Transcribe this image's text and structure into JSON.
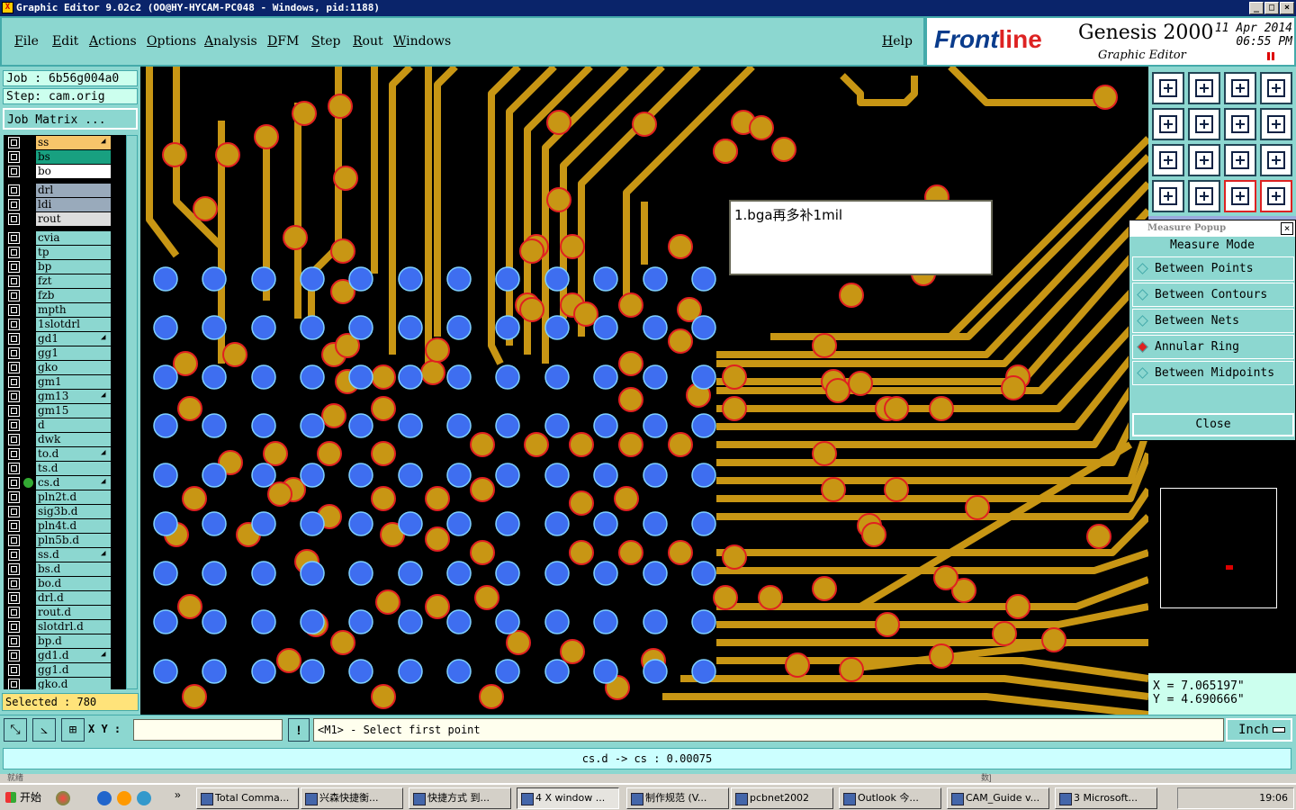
{
  "title": "Graphic Editor 9.02c2  (OO@HY-HYCAM-PC048 - Windows, pid:1188)",
  "menu": [
    "File",
    "Edit",
    "Actions",
    "Options",
    "Analysis",
    "DFM",
    "Step",
    "Rout",
    "Windows"
  ],
  "help": "Help",
  "brand": {
    "logo_a": "Front",
    "logo_b": "line",
    "product": "Genesis 2000",
    "subtitle": "Graphic Editor",
    "date": "11 Apr 2014",
    "time": "06:55 PM"
  },
  "job": "Job : 6b56g004a0",
  "step": "Step: cam.orig",
  "job_matrix": "Job Matrix ...",
  "layers": [
    {
      "name": "ss",
      "color": "#f7c56a",
      "mark": "◢"
    },
    {
      "name": "bs",
      "color": "#18a080",
      "mark": ""
    },
    {
      "name": "bo",
      "color": "#ffffff",
      "mark": ""
    },
    {
      "name": "drl",
      "color": "#9ab",
      "mark": "",
      "gap": true
    },
    {
      "name": "ldi",
      "color": "#9ab",
      "mark": ""
    },
    {
      "name": "rout",
      "color": "#ddd",
      "mark": ""
    },
    {
      "name": "cvia",
      "color": "#8cd7d0",
      "mark": "",
      "gap": true
    },
    {
      "name": "tp",
      "color": "#8cd7d0",
      "mark": ""
    },
    {
      "name": "bp",
      "color": "#8cd7d0",
      "mark": ""
    },
    {
      "name": "fzt",
      "color": "#8cd7d0",
      "mark": ""
    },
    {
      "name": "fzb",
      "color": "#8cd7d0",
      "mark": ""
    },
    {
      "name": "mpth",
      "color": "#8cd7d0",
      "mark": ""
    },
    {
      "name": "1slotdrl",
      "color": "#8cd7d0",
      "mark": ""
    },
    {
      "name": "gd1",
      "color": "#8cd7d0",
      "mark": "◢"
    },
    {
      "name": "gg1",
      "color": "#8cd7d0",
      "mark": ""
    },
    {
      "name": "gko",
      "color": "#8cd7d0",
      "mark": ""
    },
    {
      "name": "gm1",
      "color": "#8cd7d0",
      "mark": ""
    },
    {
      "name": "gm13",
      "color": "#8cd7d0",
      "mark": "◢"
    },
    {
      "name": "gm15",
      "color": "#8cd7d0",
      "mark": ""
    },
    {
      "name": "d",
      "color": "#8cd7d0",
      "mark": ""
    },
    {
      "name": "dwk",
      "color": "#8cd7d0",
      "mark": ""
    },
    {
      "name": "to.d",
      "color": "#8cd7d0",
      "mark": "◢"
    },
    {
      "name": "ts.d",
      "color": "#8cd7d0",
      "mark": ""
    },
    {
      "name": "cs.d",
      "color": "#8cd7d0",
      "mark": "◢",
      "active": true
    },
    {
      "name": "pln2t.d",
      "color": "#8cd7d0",
      "mark": ""
    },
    {
      "name": "sig3b.d",
      "color": "#8cd7d0",
      "mark": ""
    },
    {
      "name": "pln4t.d",
      "color": "#8cd7d0",
      "mark": ""
    },
    {
      "name": "pln5b.d",
      "color": "#8cd7d0",
      "mark": ""
    },
    {
      "name": "ss.d",
      "color": "#8cd7d0",
      "mark": "◢"
    },
    {
      "name": "bs.d",
      "color": "#8cd7d0",
      "mark": ""
    },
    {
      "name": "bo.d",
      "color": "#8cd7d0",
      "mark": ""
    },
    {
      "name": "drl.d",
      "color": "#8cd7d0",
      "mark": ""
    },
    {
      "name": "rout.d",
      "color": "#8cd7d0",
      "mark": ""
    },
    {
      "name": "slotdrl.d",
      "color": "#8cd7d0",
      "mark": ""
    },
    {
      "name": "bp.d",
      "color": "#8cd7d0",
      "mark": ""
    },
    {
      "name": "gd1.d",
      "color": "#8cd7d0",
      "mark": "◢"
    },
    {
      "name": "gg1.d",
      "color": "#8cd7d0",
      "mark": ""
    },
    {
      "name": "gko.d",
      "color": "#8cd7d0",
      "mark": ""
    }
  ],
  "selected": "Selected : 780",
  "note": "1.bga再多补1mil",
  "measure": {
    "title": "Measure Popup",
    "mode_label": "Measure Mode",
    "options": [
      "Between Points",
      "Between Contours",
      "Between Nets",
      "Annular Ring",
      "Between Midpoints"
    ],
    "selected_option": "Annular Ring",
    "close": "Close"
  },
  "coords": {
    "x": "X = 7.065197\"",
    "y": "Y = 4.690666\""
  },
  "xy_label": "X Y :",
  "prompt": "<M1> - Select first point",
  "unit": "Inch",
  "status": "cs.d -> cs : 0.00075",
  "statusline": "就绪",
  "statusline_right": "数]",
  "colors": {
    "board": "#000000",
    "trace": "#c89614",
    "pad": "#c89614",
    "pad_ring": "#e02020",
    "bga": "#3e6ef0",
    "bga_ring": "#7fd0ff"
  },
  "taskbar": {
    "start": "开始",
    "tasks": [
      "Total Comma...",
      "兴森快捷衡...",
      "快捷方式 到...",
      "4 X window ...",
      "制作规范 (V...",
      "pcbnet2002",
      "Outlook 今...",
      "CAM_Guide v...",
      "3 Microsoft..."
    ],
    "active_task": 3,
    "clock": "19:06"
  }
}
